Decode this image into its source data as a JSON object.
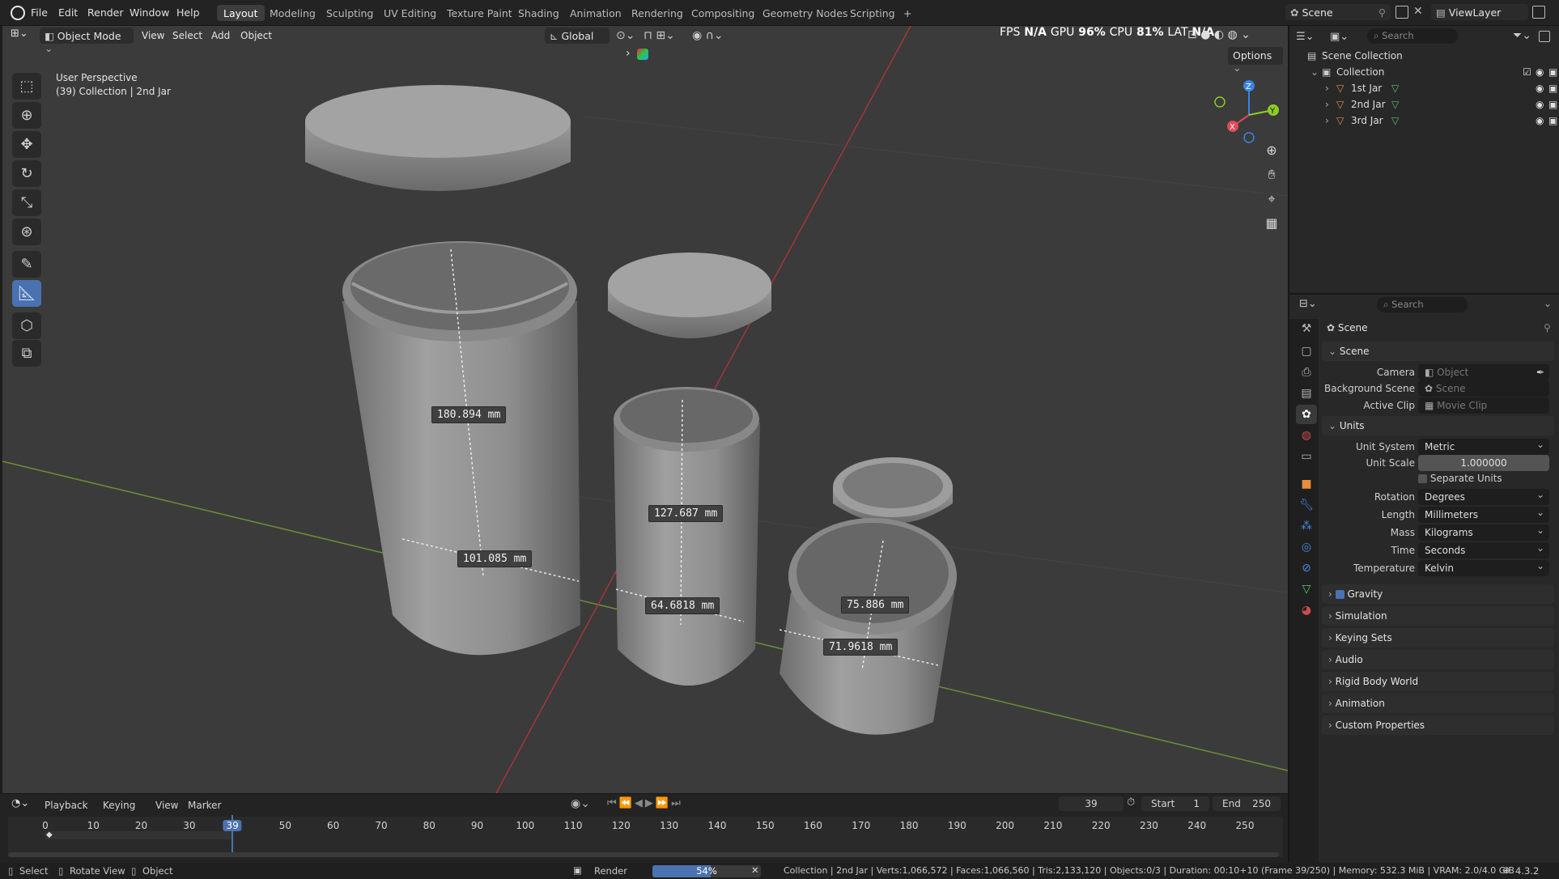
{
  "topbar": {
    "menus": [
      "File",
      "Edit",
      "Render",
      "Window",
      "Help"
    ],
    "workspaces": [
      "Layout",
      "Modeling",
      "Sculpting",
      "UV Editing",
      "Texture Paint",
      "Shading",
      "Animation",
      "Rendering",
      "Compositing",
      "Geometry Nodes",
      "Scripting"
    ],
    "active_workspace": "Layout",
    "add_tab": "+",
    "scene_name": "Scene",
    "view_layer": "ViewLayer"
  },
  "viewport_header": {
    "mode": "Object Mode",
    "menus": [
      "View",
      "Select",
      "Add",
      "Object"
    ],
    "orientation": "Global",
    "stats": {
      "fps_label": "FPS",
      "fps": "N/A",
      "gpu_label": "GPU",
      "gpu": "96%",
      "cpu_label": "CPU",
      "cpu": "81%",
      "lat_label": "LAT",
      "lat": "N/A"
    },
    "options": "Options"
  },
  "viewport": {
    "view_name": "User Perspective",
    "context": "(39) Collection | 2nd Jar",
    "measurements": [
      "180.894 mm",
      "101.085 mm",
      "127.687 mm",
      "64.6818 mm",
      "75.886 mm",
      "71.9618 mm"
    ],
    "gizmo": {
      "x": "X",
      "y": "Y",
      "z": "Z"
    }
  },
  "outliner": {
    "search_placeholder": "Search",
    "root": "Scene Collection",
    "collection": "Collection",
    "objects": [
      "1st Jar",
      "2nd Jar",
      "3rd Jar"
    ]
  },
  "properties": {
    "search_placeholder": "Search",
    "context_title": "Scene",
    "scene_panel": {
      "title": "Scene",
      "camera_label": "Camera",
      "camera_value": "Object",
      "bg_label": "Background Scene",
      "bg_value": "Scene",
      "clip_label": "Active Clip",
      "clip_value": "Movie Clip"
    },
    "units_panel": {
      "title": "Units",
      "rows": [
        {
          "label": "Unit System",
          "value": "Metric"
        },
        {
          "label": "Unit Scale",
          "value": "1.000000"
        },
        {
          "label": "Rotation",
          "value": "Degrees"
        },
        {
          "label": "Length",
          "value": "Millimeters"
        },
        {
          "label": "Mass",
          "value": "Kilograms"
        },
        {
          "label": "Time",
          "value": "Seconds"
        },
        {
          "label": "Temperature",
          "value": "Kelvin"
        }
      ],
      "separate_units": "Separate Units"
    },
    "collapsed_sections": [
      "Gravity",
      "Simulation",
      "Keying Sets",
      "Audio",
      "Rigid Body World",
      "Animation",
      "Custom Properties"
    ]
  },
  "timeline": {
    "menus": [
      "Playback",
      "Keying",
      "View",
      "Marker"
    ],
    "current_frame": "39",
    "start_label": "Start",
    "start": "1",
    "end_label": "End",
    "end": "250",
    "ticks": [
      "0",
      "10",
      "20",
      "30",
      "39",
      "50",
      "60",
      "70",
      "80",
      "90",
      "100",
      "110",
      "120",
      "130",
      "140",
      "150",
      "160",
      "170",
      "180",
      "190",
      "200",
      "210",
      "220",
      "230",
      "240",
      "250"
    ]
  },
  "statusbar": {
    "select": "Select",
    "rotate": "Rotate View",
    "object": "Object",
    "render_label": "Render",
    "render_progress": "54%",
    "render_progress_value": 54,
    "info": "Collection | 2nd Jar | Verts:1,066,572 | Faces:1,066,560 | Tris:2,133,120 | Objects:0/3 | Duration: 00:10+10 (Frame 39/250) | Memory: 532.3 MiB | VRAM: 2.0/4.0 GiB",
    "version": "4.3.2"
  },
  "colors": {
    "accent": "#4a72b0",
    "x_axis": "#e04a5a",
    "y_axis": "#8ccd26",
    "z_axis": "#3b82e6",
    "selected_outline": "#f2a14a"
  }
}
